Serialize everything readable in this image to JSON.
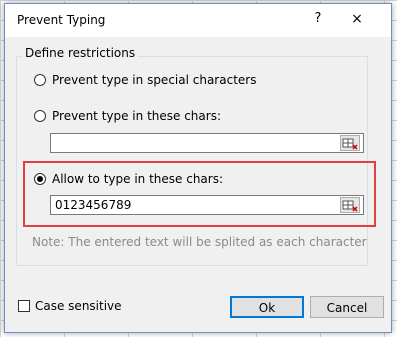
{
  "window": {
    "title": "Prevent Typing",
    "help_glyph": "?",
    "close_glyph": "×"
  },
  "restrictions": {
    "legend": "Define restrictions",
    "options": [
      {
        "label": "Prevent type in special characters",
        "checked": false
      },
      {
        "label": "Prevent type in these chars:",
        "checked": false,
        "value": ""
      },
      {
        "label": "Allow to type in these chars:",
        "checked": true,
        "value": "0123456789"
      }
    ],
    "note": "Note: The entered text will be splited as each character"
  },
  "footer": {
    "case_sensitive_label": "Case sensitive",
    "case_sensitive_checked": false,
    "ok_label": "Ok",
    "cancel_label": "Cancel"
  },
  "colors": {
    "highlight": "#e04040",
    "default_button_border": "#0078d7"
  }
}
